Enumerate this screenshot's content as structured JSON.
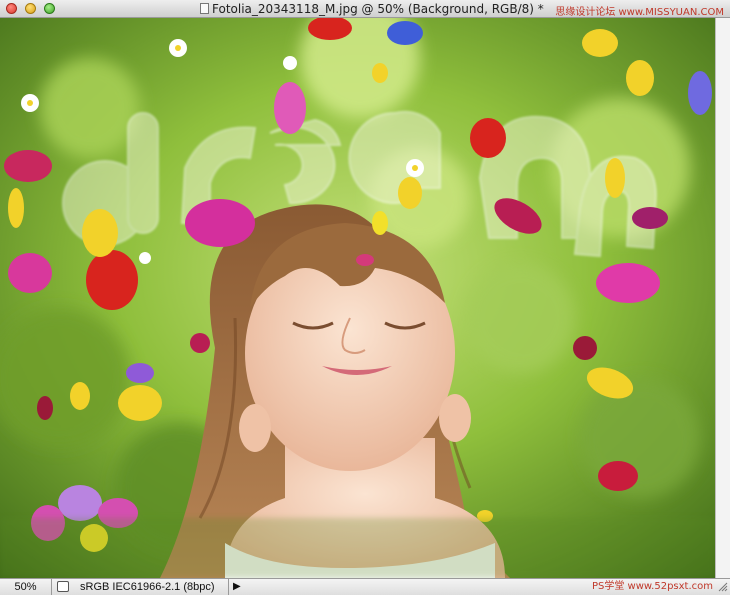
{
  "window": {
    "title": "Fotolia_20343118_M.jpg @ 50% (Background, RGB/8) *",
    "watermark_top": "思缘设计论坛 www.MISSYUAN.COM"
  },
  "canvas": {
    "overlay_text": "dream"
  },
  "status": {
    "zoom": "50%",
    "profile": "sRGB IEC61966-2.1 (8bpc)",
    "watermark_bottom": "PS学堂 www.52psxt.com"
  },
  "colors": {
    "background_green": "#5f8f26",
    "light_green": "#b8d96a",
    "petal_magenta": "#e0389a",
    "petal_red": "#d8241e",
    "petal_yellow": "#f2d22a",
    "watermark_red": "#c0392b"
  },
  "icons": {
    "close": "close-icon",
    "minimize": "minimize-icon",
    "zoom": "zoom-icon",
    "document": "document-icon",
    "status_menu": "chevron-right-icon"
  }
}
